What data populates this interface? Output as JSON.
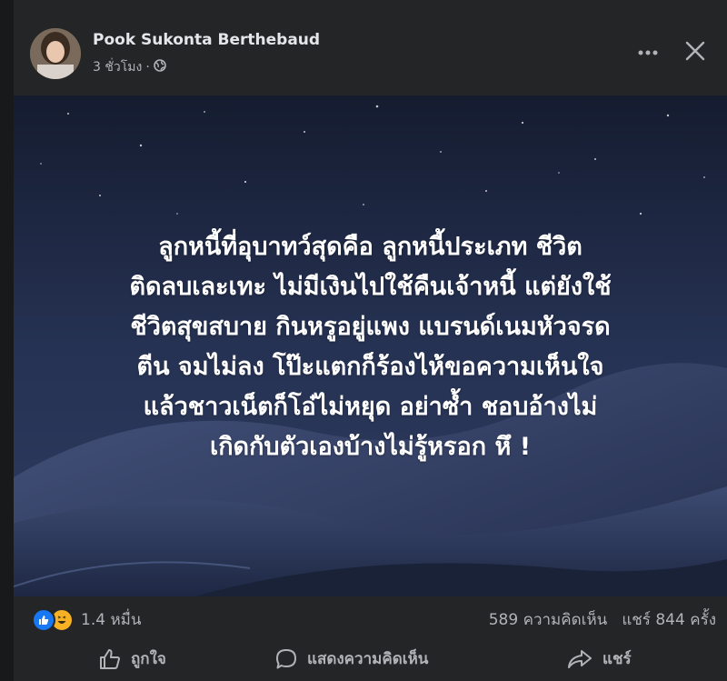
{
  "post": {
    "author": "Pook Sukonta Berthebaud",
    "time": "3 ชั่วโมง",
    "separator": "·",
    "privacy_icon": "globe-icon",
    "text_lines": [
      "ลูกหนี้ที่อุบาทว์สุดคือ ลูกหนี้ประเภท ชีวิต",
      "ติดลบเละเทะ ไม่มีเงินไปใช้คืนเจ้าหนี้ แต่ยังใช้",
      "ชีวิตสุขสบาย กินหรูอยู่แพง แบรนด์เนมหัวจรด",
      "ตีน จมไม่ลง โป๊ะแตกก็ร้องไห้ขอความเห็นใจ",
      "แล้วชาวเน็ตก็โอ๋ไม่หยุด อย่าซ้ำ ชอบอ้างไม่",
      "เกิดกับตัวเองบ้างไม่รู้หรอก หึ !"
    ]
  },
  "stats": {
    "reaction_icons": [
      "like-icon",
      "haha-icon"
    ],
    "reactions": "1.4 หมื่น",
    "comments": "589 ความคิดเห็น",
    "shares": "แชร์ 844 ครั้ง"
  },
  "actions": {
    "like": "ถูกใจ",
    "comment": "แสดงความคิดเห็น",
    "share": "แชร์"
  },
  "colors": {
    "card_bg": "#242526",
    "page_bg": "#18191a",
    "like_blue": "#1877f2",
    "haha_yellow": "#f7b125",
    "secondary_text": "#b0b3b8"
  }
}
